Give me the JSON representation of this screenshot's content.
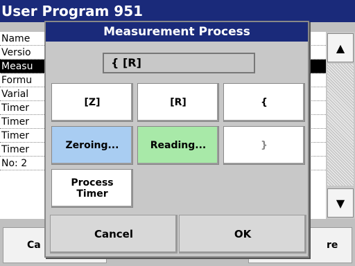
{
  "background": {
    "title": "User Program  951",
    "list_rows": [
      "Name",
      "Versio",
      "Measu",
      "Formu",
      "Varial",
      "Timer",
      "Timer",
      "Timer",
      "Timer",
      "No: 2"
    ],
    "selected_row_index": 2,
    "bottom_left_label": "Ca",
    "bottom_right_label": "re",
    "scroll_up_icon": "arrow-up-icon",
    "scroll_down_icon": "arrow-down-icon"
  },
  "dialog": {
    "title": "Measurement Process",
    "display_value": "{ [R]",
    "keys": {
      "z": "[Z]",
      "r": "[R]",
      "open_brace": "{",
      "zeroing": "Zeroing...",
      "reading": "Reading...",
      "close_brace": "}",
      "process_timer": "Process Timer"
    },
    "cancel_label": "Cancel",
    "ok_label": "OK"
  },
  "colors": {
    "title_bar": "#1a2a7a",
    "zeroing_key": "#a9cdf2",
    "reading_key": "#a8e9a8"
  }
}
